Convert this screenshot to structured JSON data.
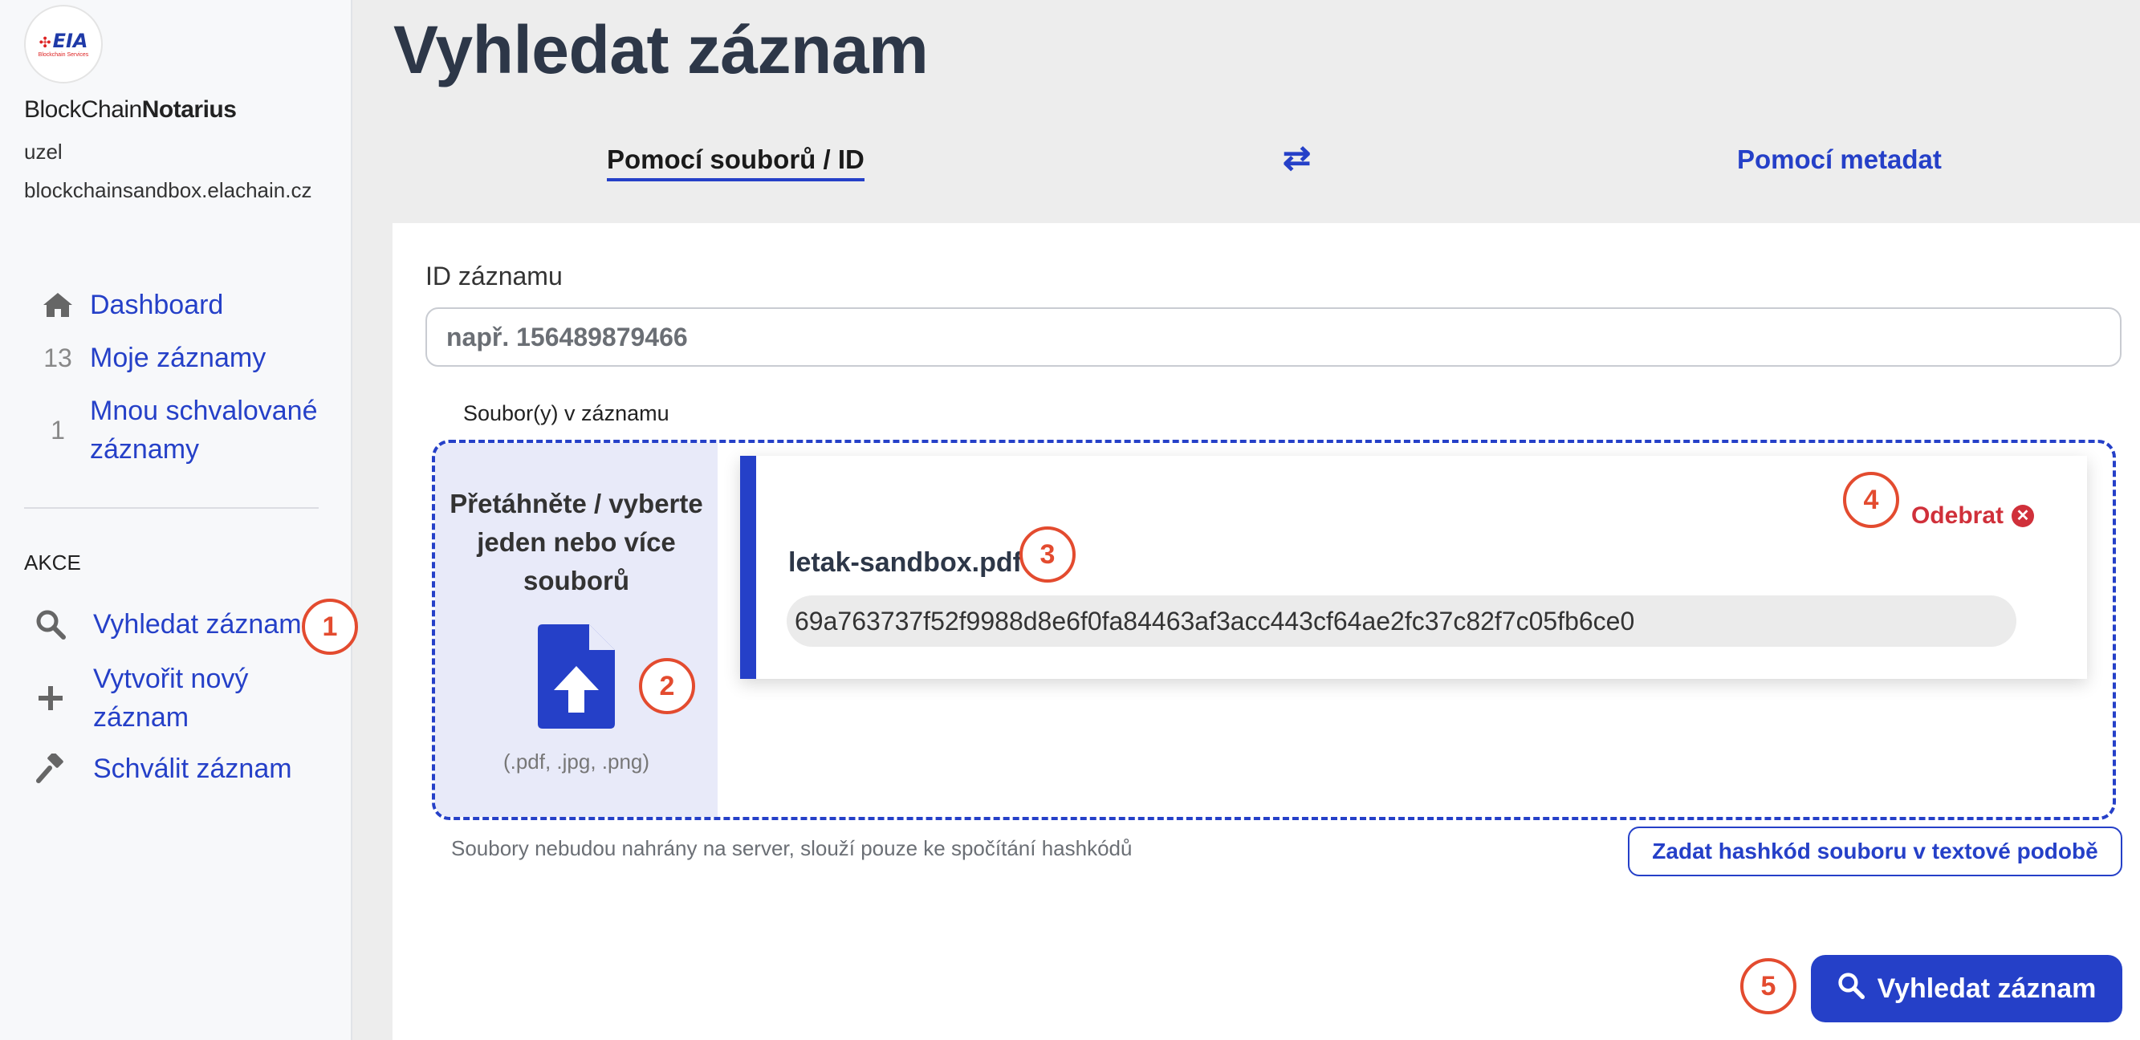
{
  "sidebar": {
    "logo_text": "EIA",
    "logo_subtext": "Blockchain Services",
    "brand_prefix": "BlockChain",
    "brand_bold": "Notarius",
    "node_label": "uzel",
    "node_host": "blockchainsandbox.elachain.cz",
    "nav": [
      {
        "icon": "home-icon",
        "label": "Dashboard"
      },
      {
        "count": "13",
        "label": "Moje záznamy"
      },
      {
        "count": "1",
        "label": "Mnou schvalované záznamy"
      }
    ],
    "section_label": "AKCE",
    "actions": [
      {
        "icon": "search-icon",
        "label": "Vyhledat záznam"
      },
      {
        "icon": "plus-icon",
        "label": "Vytvořit nový záznam"
      },
      {
        "icon": "gavel-icon",
        "label": "Schválit záznam"
      }
    ]
  },
  "main": {
    "title": "Vyhledat záznam",
    "tabs": [
      {
        "label": "Pomocí souborů / ID",
        "active": true
      },
      {
        "label": "Pomocí metadat",
        "active": false
      }
    ],
    "swap_icon": "swap-arrows-icon",
    "id_field": {
      "label": "ID záznamu",
      "placeholder": "např. 156489879466",
      "value": ""
    },
    "files_label": "Soubor(y) v záznamu",
    "dropzone": {
      "text": "Přetáhněte / vyberte jeden nebo více souborů",
      "types": "(.pdf, .jpg, .png)",
      "icon": "file-upload-icon"
    },
    "file": {
      "name": "letak-sandbox.pdf",
      "hash": "69a763737f52f9988d8e6f0fa84463af3acc443cf64ae2fc37c82f7c05fb6ce0",
      "remove_label": "Odebrat"
    },
    "note": "Soubory nebudou nahrány na server, slouží pouze ke spočítání hashkódů",
    "hash_button": "Zadat hashkód souboru v textové podobě",
    "search_button": "Vyhledat záznam"
  },
  "markers": [
    "1",
    "2",
    "3",
    "4",
    "5"
  ],
  "colors": {
    "accent": "#2540c8",
    "marker": "#e34b2f",
    "danger": "#d0303a"
  }
}
